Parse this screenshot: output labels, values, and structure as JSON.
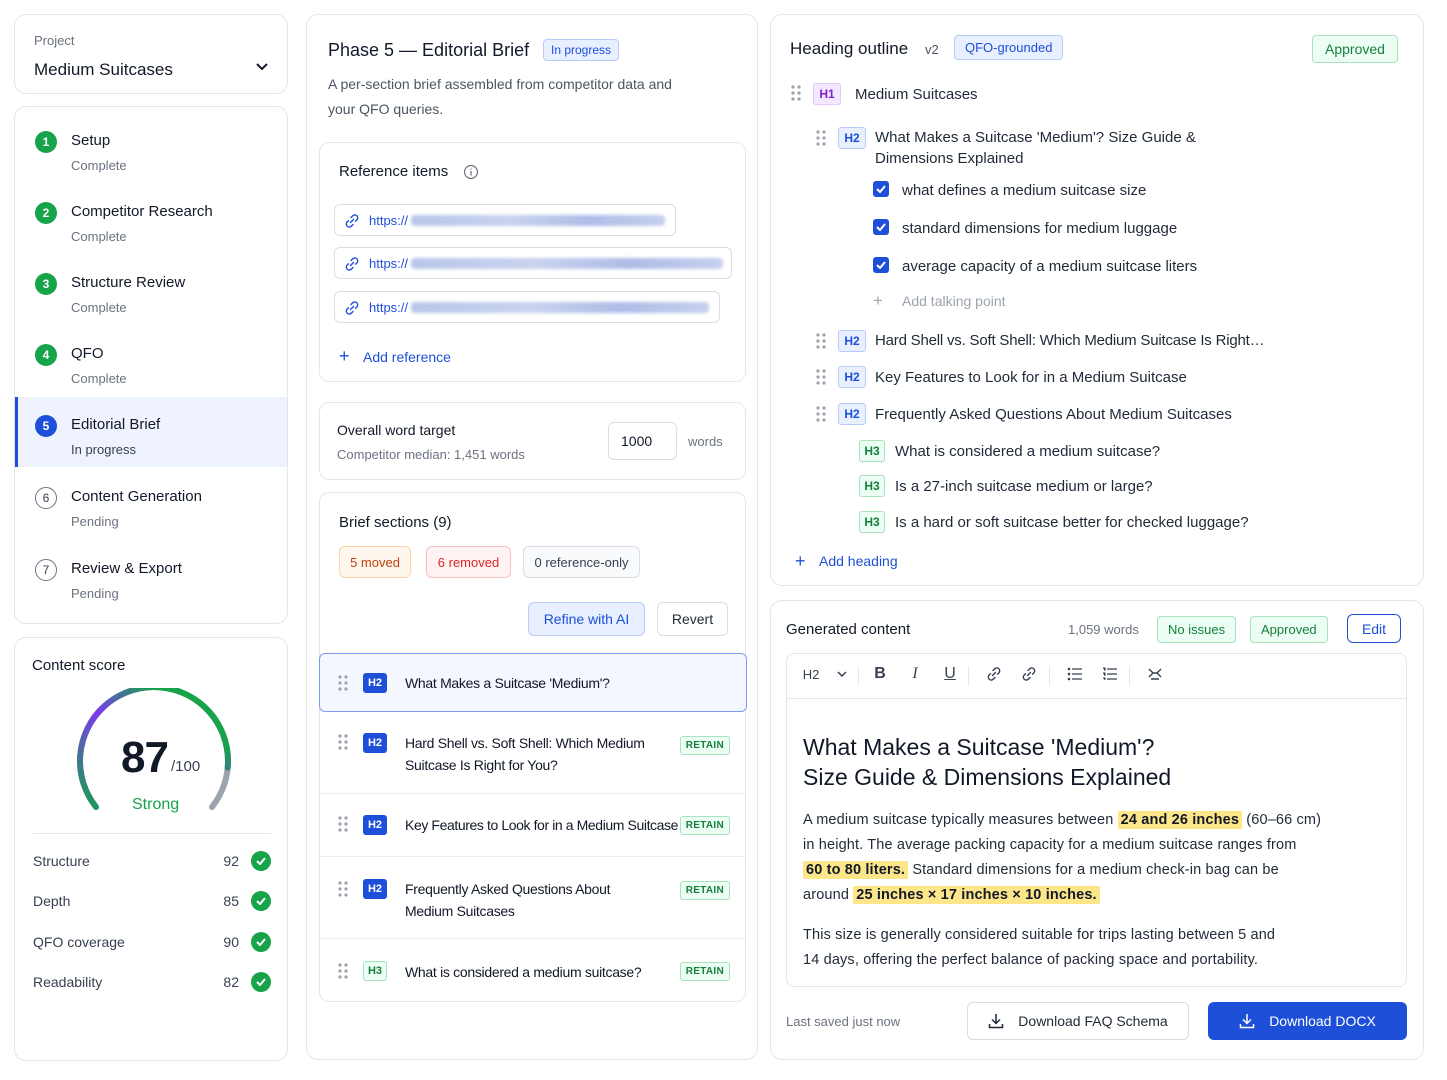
{
  "project": {
    "label": "Project",
    "name": "Medium Suitcases"
  },
  "steps": [
    {
      "num": "1",
      "title": "Setup",
      "status": "Complete"
    },
    {
      "num": "2",
      "title": "Competitor Research",
      "status": "Complete"
    },
    {
      "num": "3",
      "title": "Structure Review",
      "status": "Complete"
    },
    {
      "num": "4",
      "title": "QFO",
      "status": "Complete"
    },
    {
      "num": "5",
      "title": "Editorial Brief",
      "status": "In progress"
    },
    {
      "num": "6",
      "title": "Content Generation",
      "status": "Pending"
    },
    {
      "num": "7",
      "title": "Review & Export",
      "status": "Pending"
    }
  ],
  "score": {
    "title": "Content score",
    "value": "87",
    "max": "/100",
    "fraction": 0.87,
    "label": "Strong",
    "metrics": [
      {
        "name": "Structure",
        "value": "92"
      },
      {
        "name": "Depth",
        "value": "85"
      },
      {
        "name": "QFO coverage",
        "value": "90"
      },
      {
        "name": "Readability",
        "value": "82"
      }
    ]
  },
  "brief": {
    "title": "Phase 5 — Editorial Brief",
    "status": "In progress",
    "description_1": "A per-section brief assembled from competitor data and",
    "description_2": "your QFO queries.",
    "references": {
      "title": "Reference items",
      "items": [
        "https://",
        "https://",
        "https://"
      ],
      "add_label": "Add reference"
    },
    "word_target": {
      "title": "Overall word target",
      "sub": "Competitor median: 1,451 words",
      "value": "1000",
      "unit": "words"
    },
    "sections": {
      "title": "Brief sections (9)",
      "tags": [
        "5 moved",
        "6 removed",
        "0 reference-only"
      ],
      "refine_label": "Refine with AI",
      "revert_label": "Revert",
      "items": [
        {
          "level": "H2",
          "line1": "What Makes a Suitcase 'Medium'?",
          "line2": "",
          "tag": ""
        },
        {
          "level": "H2",
          "line1": "Hard Shell vs. Soft Shell: Which Medium",
          "line2": "Suitcase Is Right for You?",
          "tag": "RETAIN"
        },
        {
          "level": "H2",
          "line1": "Key Features to Look for in a Medium Suitcase",
          "line2": "",
          "tag": "RETAIN"
        },
        {
          "level": "H2",
          "line1": "Frequently Asked Questions About",
          "line2": "Medium Suitcases",
          "tag": "RETAIN"
        },
        {
          "level": "H3",
          "line1": "What is considered a medium suitcase?",
          "line2": "",
          "tag": "RETAIN"
        }
      ]
    }
  },
  "outline": {
    "title": "Heading outline",
    "version": "v2",
    "badge": "QFO-grounded",
    "approved": "Approved",
    "h1": {
      "level": "H1",
      "text": "Medium Suitcases"
    },
    "h2_first": {
      "level": "H2",
      "line1": "What Makes a Suitcase 'Medium'? Size Guide &",
      "line2": "Dimensions Explained"
    },
    "talking_points": [
      "what defines a medium suitcase size",
      "standard dimensions for medium luggage",
      "average capacity of a medium suitcase liters"
    ],
    "add_point": "Add talking point",
    "h2_more": [
      {
        "level": "H2",
        "text": "Hard Shell vs. Soft Shell: Which Medium Suitcase Is Right…"
      },
      {
        "level": "H2",
        "text": "Key Features to Look for in a Medium Suitcase"
      },
      {
        "level": "H2",
        "text": "Frequently Asked Questions About Medium Suitcases"
      }
    ],
    "h3s": [
      {
        "level": "H3",
        "text": "What is considered a medium suitcase?"
      },
      {
        "level": "H3",
        "text": "Is a 27-inch suitcase medium or large?"
      },
      {
        "level": "H3",
        "text": "Is a hard or soft suitcase better for checked luggage?"
      }
    ],
    "add_heading": "Add heading"
  },
  "generated": {
    "title": "Generated content",
    "words": "1,059 words",
    "no_issues": "No issues",
    "approved": "Approved",
    "edit": "Edit",
    "toolbar_style": "H2",
    "heading_1": "What Makes a Suitcase 'Medium'?",
    "heading_2": "Size Guide & Dimensions Explained",
    "p1": {
      "a": "A medium suitcase typically measures between",
      "h1": "24 and 26 inches",
      "b": "(60–66 cm)",
      "c": "in height. The average packing capacity for a medium suitcase ranges from",
      "h2": "60 to 80 liters.",
      "d": "Standard dimensions for a medium check-in bag can be",
      "e": "around",
      "h3": "25 inches × 17 inches × 10 inches."
    },
    "p2_1": "This size is generally considered suitable for trips lasting between 5 and",
    "p2_2": "14 days, offering the perfect balance of packing space and portability.",
    "saved": "Last saved just now",
    "download_faq": "Download FAQ Schema",
    "download_docx": "Download DOCX"
  },
  "colors": {
    "accent": "#1e4fd8",
    "success": "#16a34a",
    "warn": "#c2410c",
    "danger": "#dc2626",
    "highlight": "#fde68a"
  }
}
